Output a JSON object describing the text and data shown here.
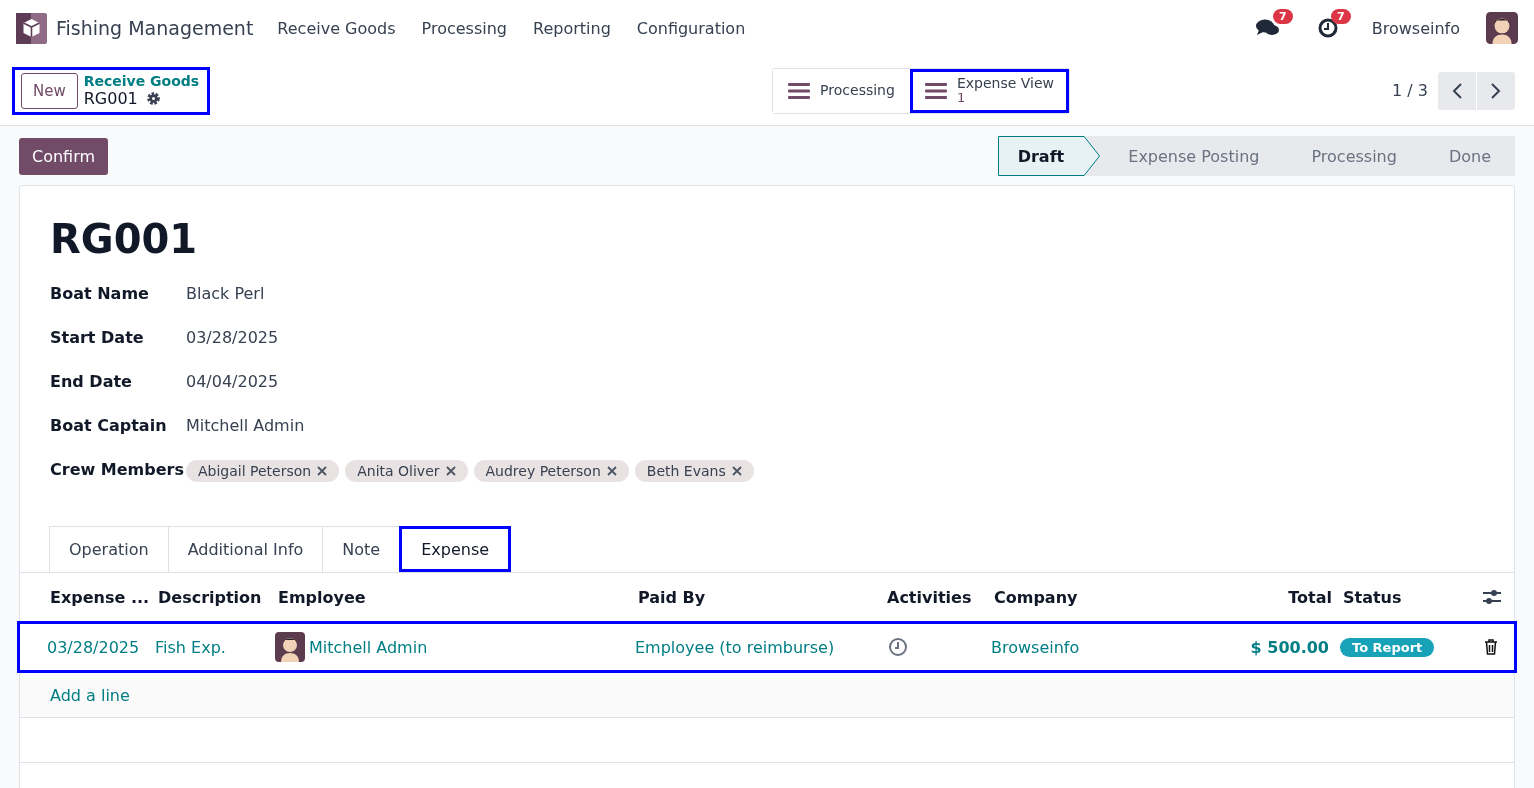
{
  "navbar": {
    "app_name": "Fishing Management",
    "menu": [
      "Receive Goods",
      "Processing",
      "Reporting",
      "Configuration"
    ],
    "messages_badge": "7",
    "activities_badge": "7",
    "user": "Browseinfo"
  },
  "control_panel": {
    "highlighted": true,
    "new_button": "New",
    "breadcrumb": "Receive Goods",
    "record": "RG001",
    "pager": "1 / 3",
    "smart_buttons": [
      {
        "label": "Processing",
        "highlighted": false
      },
      {
        "label": "Expense View",
        "value": "1",
        "highlighted": true
      }
    ]
  },
  "confirm_button": "Confirm",
  "statusbar": [
    {
      "label": "Draft",
      "selected": true
    },
    {
      "label": "Expense Posting",
      "selected": false
    },
    {
      "label": "Processing",
      "selected": false
    },
    {
      "label": "Done",
      "selected": false
    }
  ],
  "form": {
    "title": "RG001",
    "fields": [
      {
        "kind": "text",
        "label": "Boat Name",
        "value": "Black Perl"
      },
      {
        "kind": "text",
        "label": "Start Date",
        "value": "03/28/2025"
      },
      {
        "kind": "text",
        "label": "End Date",
        "value": "04/04/2025"
      },
      {
        "kind": "text",
        "label": "Boat Captain",
        "value": "Mitchell Admin"
      },
      {
        "kind": "tags",
        "label": "Crew Members",
        "tags": [
          "Abigail Peterson",
          "Anita Oliver",
          "Audrey Peterson",
          "Beth Evans"
        ]
      }
    ]
  },
  "tabs": [
    {
      "label": "Operation",
      "selected": false,
      "highlighted": false
    },
    {
      "label": "Additional Info",
      "selected": false,
      "highlighted": false
    },
    {
      "label": "Note",
      "selected": false,
      "highlighted": false
    },
    {
      "label": "Expense",
      "selected": true,
      "highlighted": true
    }
  ],
  "expense_table": {
    "columns": [
      "Expense ...",
      "Description",
      "Employee",
      "Paid By",
      "Activities",
      "Company",
      "Total",
      "Status"
    ],
    "rows": [
      {
        "highlighted": true,
        "date": "03/28/2025",
        "description": "Fish Exp.",
        "employee": "Mitchell Admin",
        "paid_by": "Employee (to reimburse)",
        "company": "Browseinfo",
        "total": "$ 500.00",
        "status": "To Report"
      }
    ],
    "add_line": "Add a line"
  }
}
